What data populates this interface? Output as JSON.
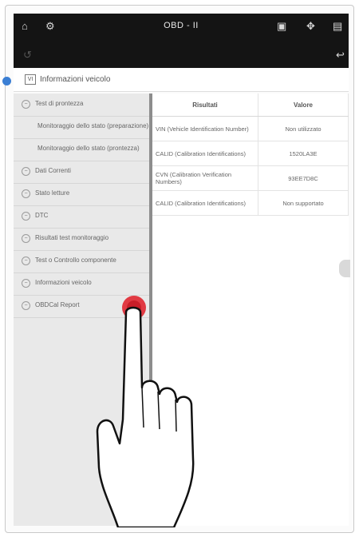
{
  "topbar": {
    "title": "OBD - II",
    "icons": [
      "home-icon",
      "settings-icon",
      "record-icon",
      "fullscreen-icon",
      "print-icon",
      "back-icon",
      "exit-icon"
    ]
  },
  "info": {
    "title": "Informazioni veicolo"
  },
  "sidebar": {
    "items": [
      {
        "label": "Test di prontezza",
        "icon": "minus-icon"
      },
      {
        "label": "Monitoraggio dello stato (preparazione)",
        "icon": "none",
        "sub": true
      },
      {
        "label": "Monitoraggio dello stato (prontezza)",
        "icon": "none",
        "sub": true
      },
      {
        "label": "Dati Correnti",
        "icon": "minus-icon"
      },
      {
        "label": "Stato letture",
        "icon": "minus-icon"
      },
      {
        "label": "DTC",
        "icon": "minus-icon"
      },
      {
        "label": "Risultati test monitoraggio",
        "icon": "minus-icon"
      },
      {
        "label": "Test o Controllo componente",
        "icon": "minus-icon"
      },
      {
        "label": "Informazioni veicolo",
        "icon": "minus-icon"
      },
      {
        "label": "OBDCal Report",
        "icon": "minus-icon"
      }
    ]
  },
  "table": {
    "headers": [
      "Risultati",
      "Valore"
    ],
    "rows": [
      [
        "VIN (Vehicle Identification Number)",
        "Non utilizzato"
      ],
      [
        "CALID (Calibration Identifications)",
        "1520LA3E"
      ],
      [
        "CVN (Calibration Verification Numbers)",
        "93EE7D8C"
      ],
      [
        "CALID (Calibration Identifications)",
        "Non supportato"
      ]
    ]
  }
}
